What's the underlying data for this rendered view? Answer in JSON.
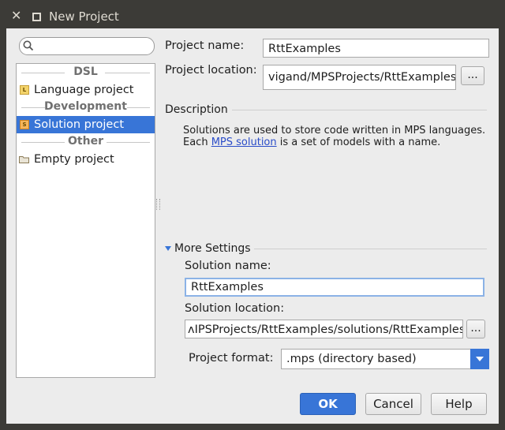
{
  "window": {
    "title": "New Project"
  },
  "tree": {
    "groups": [
      {
        "label": "DSL",
        "items": [
          {
            "label": "Language project",
            "icon": "language-icon"
          }
        ]
      },
      {
        "label": "Development",
        "items": [
          {
            "label": "Solution project",
            "icon": "solution-icon"
          }
        ]
      },
      {
        "label": "Other",
        "items": [
          {
            "label": "Empty project",
            "icon": "folder-icon"
          }
        ]
      }
    ],
    "selected": "Solution project"
  },
  "form": {
    "project_name_label": "Project name:",
    "project_name_value": "RttExamples",
    "project_location_label": "Project location:",
    "project_location_value": "vigand/MPSProjects/RttExamples",
    "browse_label": "...",
    "description_title": "Description",
    "description_text_1": "Solutions are used to store code written in MPS languages.",
    "description_text_2a": "Each ",
    "description_link": "MPS solution",
    "description_text_2b": " is a set of models with a name.",
    "more_settings_label": "More Settings",
    "solution_name_label": "Solution name:",
    "solution_name_value": "RttExamples",
    "solution_location_label": "Solution location:",
    "solution_location_value": "ʌIPSProjects/RttExamples/solutions/RttExamples",
    "project_format_label": "Project format:",
    "project_format_value": ".mps (directory based)"
  },
  "buttons": {
    "ok": "OK",
    "cancel": "Cancel",
    "help": "Help"
  },
  "colors": {
    "accent": "#3875d7",
    "titlebar": "#3c3b37",
    "link": "#2a4cc8"
  }
}
